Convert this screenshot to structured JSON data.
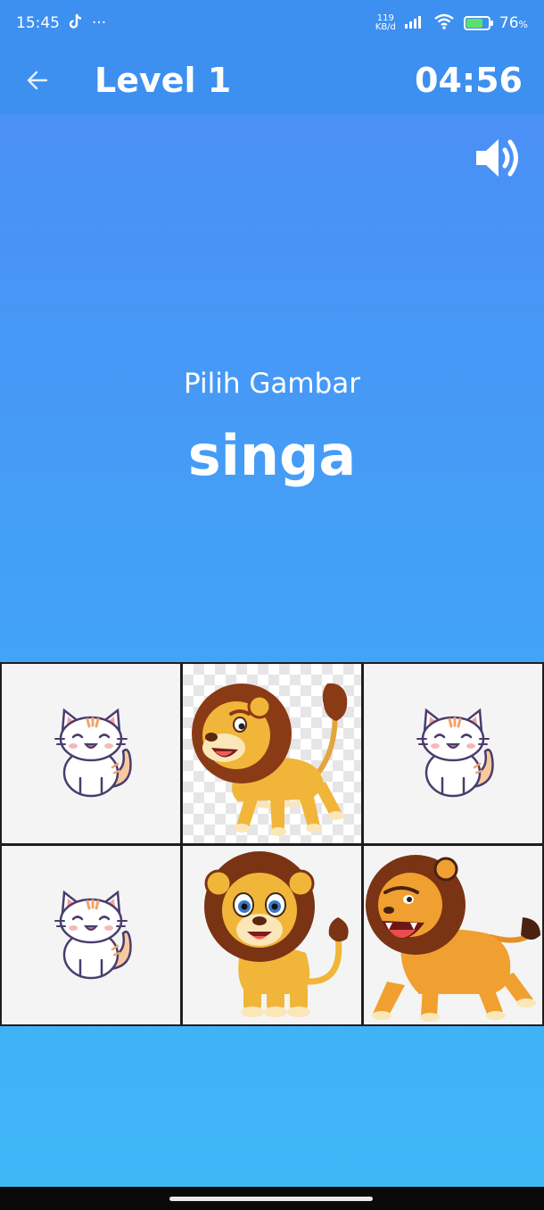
{
  "status_bar": {
    "time": "15:45",
    "more": "···",
    "net_speed_value": "119",
    "net_speed_unit": "KB/d",
    "battery_percent": "76",
    "battery_suffix": "%",
    "battery_level": 0.76,
    "icons": [
      "tiktok-icon",
      "more-dots-icon",
      "signal-icon",
      "wifi-icon",
      "battery-charging-icon"
    ]
  },
  "app_bar": {
    "back_icon": "arrow-left-icon",
    "title": "Level 1",
    "timer": "04:56"
  },
  "sound": {
    "icon": "speaker-volume-icon"
  },
  "prompt": {
    "label": "Pilih Gambar",
    "word": "singa"
  },
  "grid": {
    "tiles": [
      {
        "image": "cat"
      },
      {
        "image": "lion-walking"
      },
      {
        "image": "cat"
      },
      {
        "image": "cat"
      },
      {
        "image": "lion-cub"
      },
      {
        "image": "lion-roaring"
      }
    ]
  },
  "colors": {
    "app_bar": "#3d90ef",
    "background_top": "#4c8bf5",
    "background_bottom": "#3fb8f7",
    "grid_border": "#1e1e1e"
  }
}
